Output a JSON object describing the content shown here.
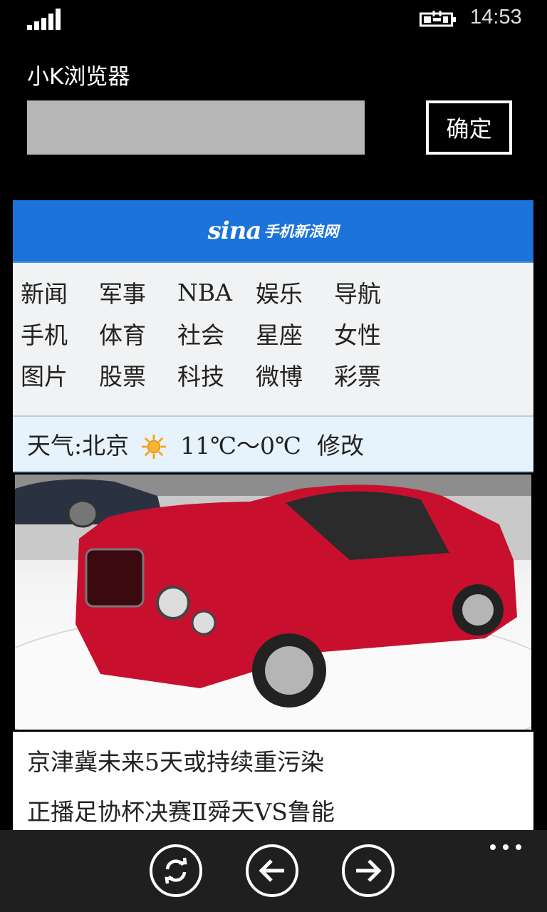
{
  "status_bar": {
    "time": "14:53",
    "signal_icon": "signal-bars-icon",
    "battery_icon": "battery-charging-icon"
  },
  "app": {
    "title": "小K浏览器",
    "url_input": {
      "value": "",
      "placeholder": ""
    },
    "confirm_label": "确定"
  },
  "page": {
    "logo": {
      "sina": "sina",
      "text": "手机新浪网"
    },
    "nav": [
      [
        "新闻",
        "军事",
        "NBA",
        "娱乐",
        "导航"
      ],
      [
        "手机",
        "体育",
        "社会",
        "星座",
        "女性"
      ],
      [
        "图片",
        "股票",
        "科技",
        "微博",
        "彩票"
      ]
    ],
    "weather": {
      "label": "天气:北京",
      "icon": "sun-icon",
      "temp": "11℃～0℃",
      "edit": "修改"
    },
    "headlines": [
      "京津冀未来5天或持续重污染",
      "正播足协杯决赛Ⅱ舜天VS鲁能"
    ]
  },
  "app_bar": {
    "buttons": [
      "refresh-icon",
      "back-arrow-icon",
      "forward-arrow-icon"
    ],
    "more": "more-dots-icon"
  },
  "colors": {
    "accent": "#1c73d9",
    "nav_bg": "#f1f2f3",
    "weather_bg": "#e7f3fc",
    "url_bg": "#b7b7b7"
  }
}
